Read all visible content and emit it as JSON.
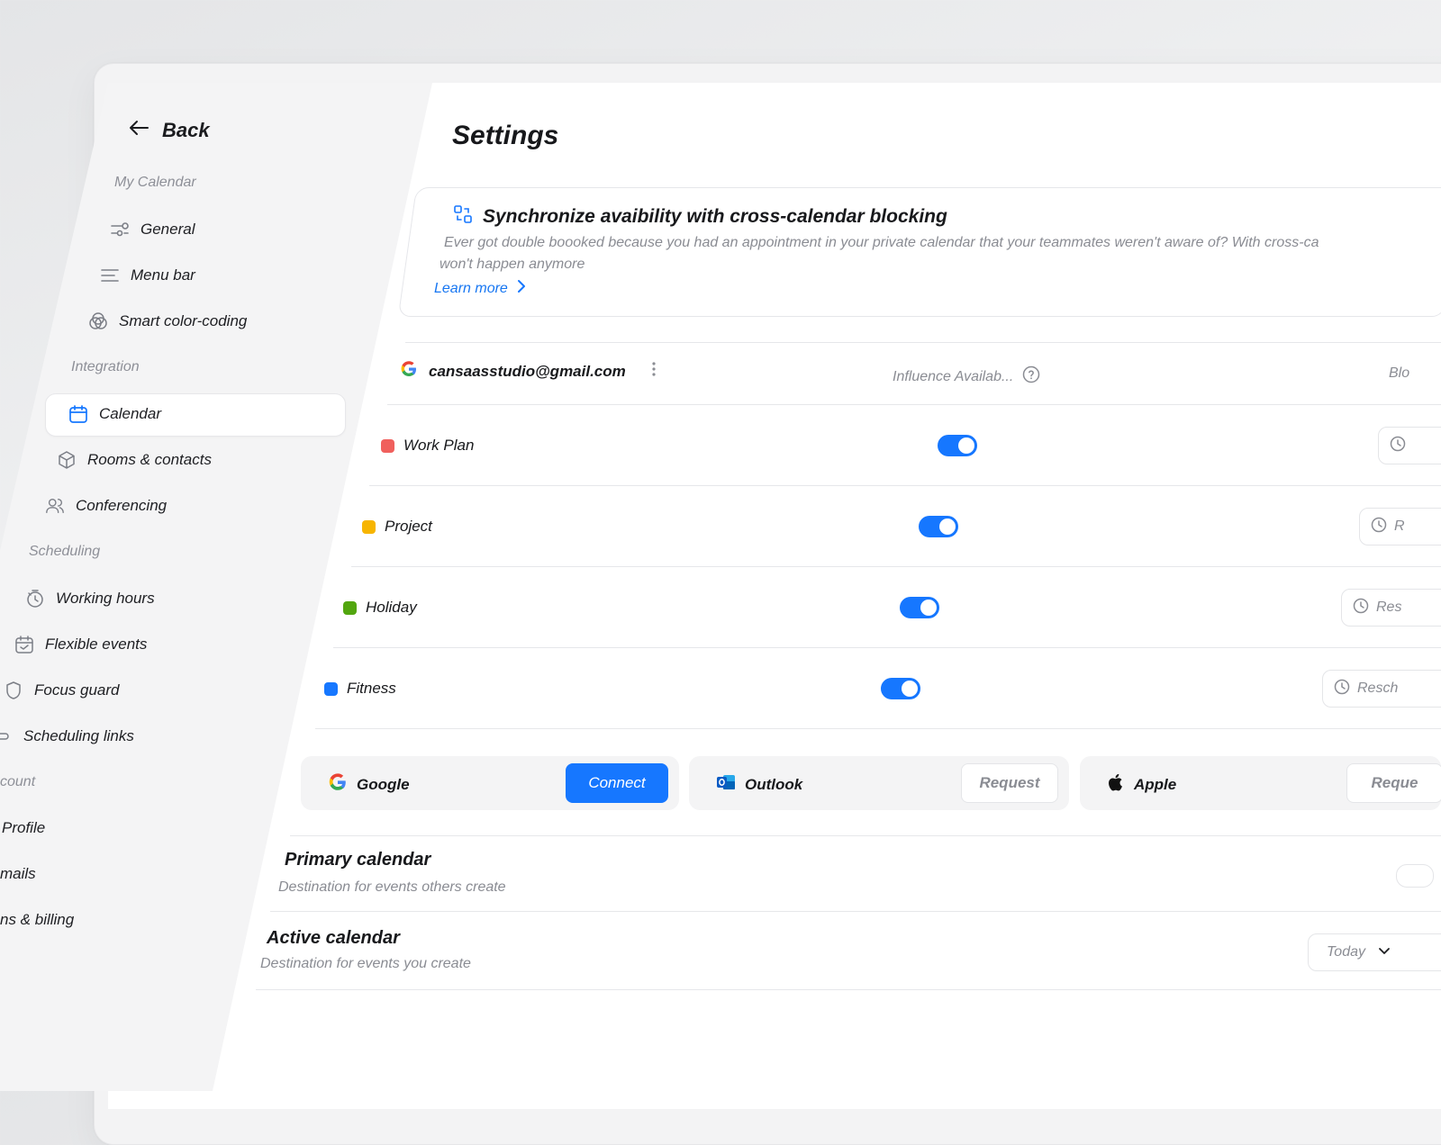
{
  "sidebar": {
    "back_label": "Back",
    "sections": {
      "my_calendar": "My Calendar",
      "integration": "Integration",
      "scheduling": "Scheduling",
      "account": "count"
    },
    "items": {
      "general": "General",
      "menu_bar": "Menu bar",
      "smart_color": "Smart color-coding",
      "calendar": "Calendar",
      "rooms": "Rooms & contacts",
      "conferencing": "Conferencing",
      "working_hours": "Working hours",
      "flexible_events": "Flexible events",
      "focus_guard": "Focus guard",
      "scheduling_links": "Scheduling links",
      "profile": "Profile",
      "emails": "mails",
      "plans_billing": "ns & billing"
    },
    "active_item": "calendar"
  },
  "main": {
    "title": "Settings",
    "banner": {
      "title": "Synchronize avaibility with cross-calendar blocking",
      "text_line1": "Ever got double boooked because you had an appointment in your private calendar that your teammates weren't aware of? With cross-ca",
      "text_line2": "won't happen anymore",
      "learn_more": "Learn more"
    },
    "account": {
      "email": "cansaasstudio@gmail.com",
      "col_influence": "Influence Availab...",
      "col_block": "Blo"
    },
    "calendars": [
      {
        "name": "Work Plan",
        "color": "#f0605d",
        "influence": true,
        "action": ""
      },
      {
        "name": "Project",
        "color": "#f7b500",
        "influence": true,
        "action": "R"
      },
      {
        "name": "Holiday",
        "color": "#52a60f",
        "influence": true,
        "action": "Res"
      },
      {
        "name": "Fitness",
        "color": "#1677ff",
        "influence": true,
        "action": "Resch"
      }
    ],
    "providers": [
      {
        "name": "Google",
        "button": "Connect"
      },
      {
        "name": "Outlook",
        "button": "Request"
      },
      {
        "name": "Apple",
        "button": "Reque"
      }
    ],
    "primary_calendar": {
      "title": "Primary calendar",
      "desc": "Destination for events others create"
    },
    "active_calendar": {
      "title": "Active calendar",
      "desc": "Destination for events you create",
      "value": "Today"
    }
  },
  "colors": {
    "accent": "#1677ff",
    "sidebar_bg": "#f4f4f5"
  }
}
